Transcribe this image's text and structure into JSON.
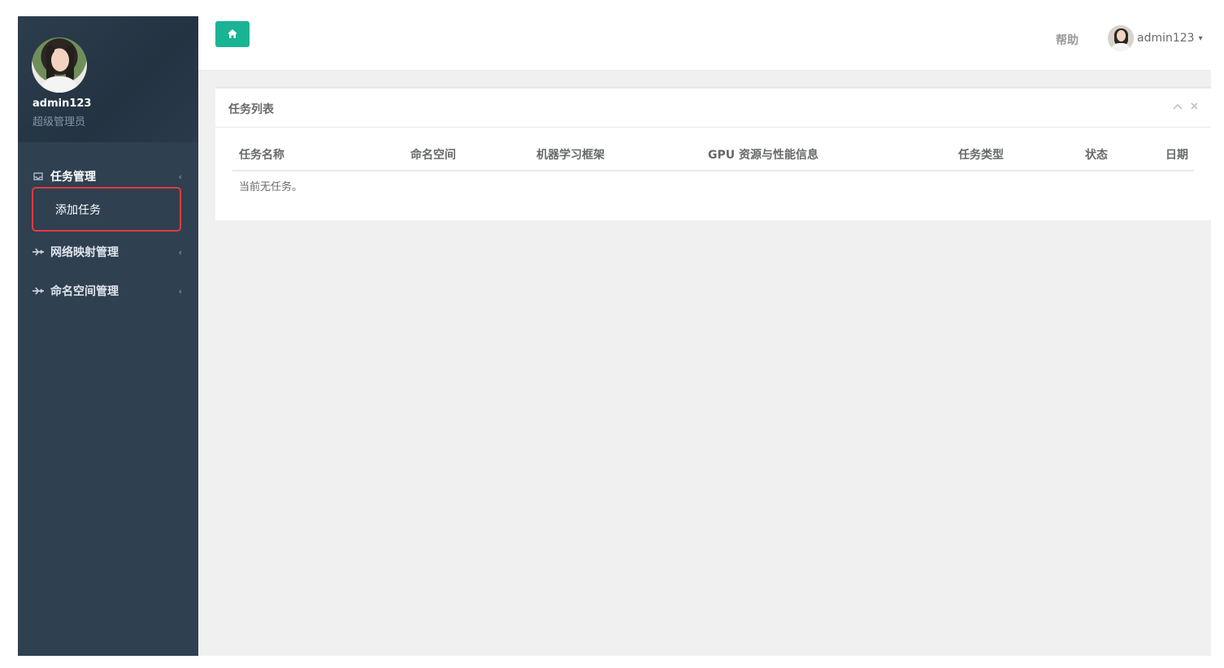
{
  "sidebar": {
    "profile": {
      "name": "admin123",
      "role": "超级管理员"
    },
    "items": [
      {
        "label": "任务管理",
        "icon": "inbox-icon",
        "expanded": true,
        "children": [
          {
            "label": "添加任务"
          }
        ]
      },
      {
        "label": "网络映射管理",
        "icon": "plane-icon",
        "expanded": false
      },
      {
        "label": "命名空间管理",
        "icon": "plane-icon",
        "expanded": false
      }
    ],
    "highlight_color": "#e53a40"
  },
  "topbar": {
    "home_icon": "home-icon",
    "help_label": "帮助",
    "user_name": "admin123",
    "accent": "#1ab394"
  },
  "panel": {
    "title": "任务列表",
    "columns": [
      "任务名称",
      "命名空间",
      "机器学习框架",
      "GPU 资源与性能信息",
      "任务类型",
      "状态",
      "日期"
    ],
    "empty_message": "当前无任务。"
  }
}
